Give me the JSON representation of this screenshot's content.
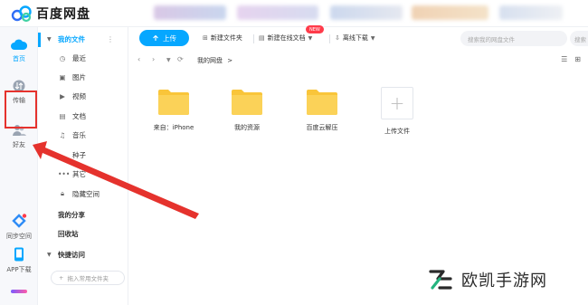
{
  "app": {
    "title": "百度网盘"
  },
  "rail": {
    "items": [
      {
        "label": "首页",
        "icon": "cloud-icon",
        "active": true
      },
      {
        "label": "传输",
        "icon": "transfer-icon",
        "active": false
      },
      {
        "label": "好友",
        "icon": "friends-icon",
        "active": false
      },
      {
        "label": "同步空间",
        "icon": "sync-space-icon",
        "active": false
      },
      {
        "label": "APP下载",
        "icon": "phone-icon",
        "active": false
      }
    ]
  },
  "sidebar": {
    "my_files": "我的文件",
    "items": [
      {
        "label": "最近",
        "icon": "clock-icon"
      },
      {
        "label": "图片",
        "icon": "image-icon"
      },
      {
        "label": "视频",
        "icon": "video-icon"
      },
      {
        "label": "文档",
        "icon": "document-icon"
      },
      {
        "label": "音乐",
        "icon": "headphones-icon"
      },
      {
        "label": "种子",
        "icon": "seed-icon"
      },
      {
        "label": "其它",
        "icon": "more-icon"
      },
      {
        "label": "隐藏空间",
        "icon": "lock-icon"
      }
    ],
    "my_share": "我的分享",
    "recycle": "回收站",
    "quick_access": "快捷访问",
    "add_common": "拖入常用文件夹"
  },
  "toolbar": {
    "upload": "上传",
    "new_folder": "新建文件夹",
    "new_online_doc": "新建在线文档",
    "new_badge": "NEW",
    "offline_download": "离线下载",
    "search_placeholder": "搜索我的网盘文件",
    "search_placeholder2": "搜索"
  },
  "path": {
    "current": "我的网盘",
    "separator": ">"
  },
  "files": [
    {
      "name": "来自：iPhone",
      "type": "folder"
    },
    {
      "name": "我的资源",
      "type": "folder"
    },
    {
      "name": "百度云解压",
      "type": "folder"
    },
    {
      "name": "上传文件",
      "type": "upload"
    }
  ],
  "watermark": {
    "text": "欧凯手游网"
  },
  "colors": {
    "accent": "#06a7ff",
    "folder": "#f9c53a",
    "highlight": "#e5322d"
  }
}
